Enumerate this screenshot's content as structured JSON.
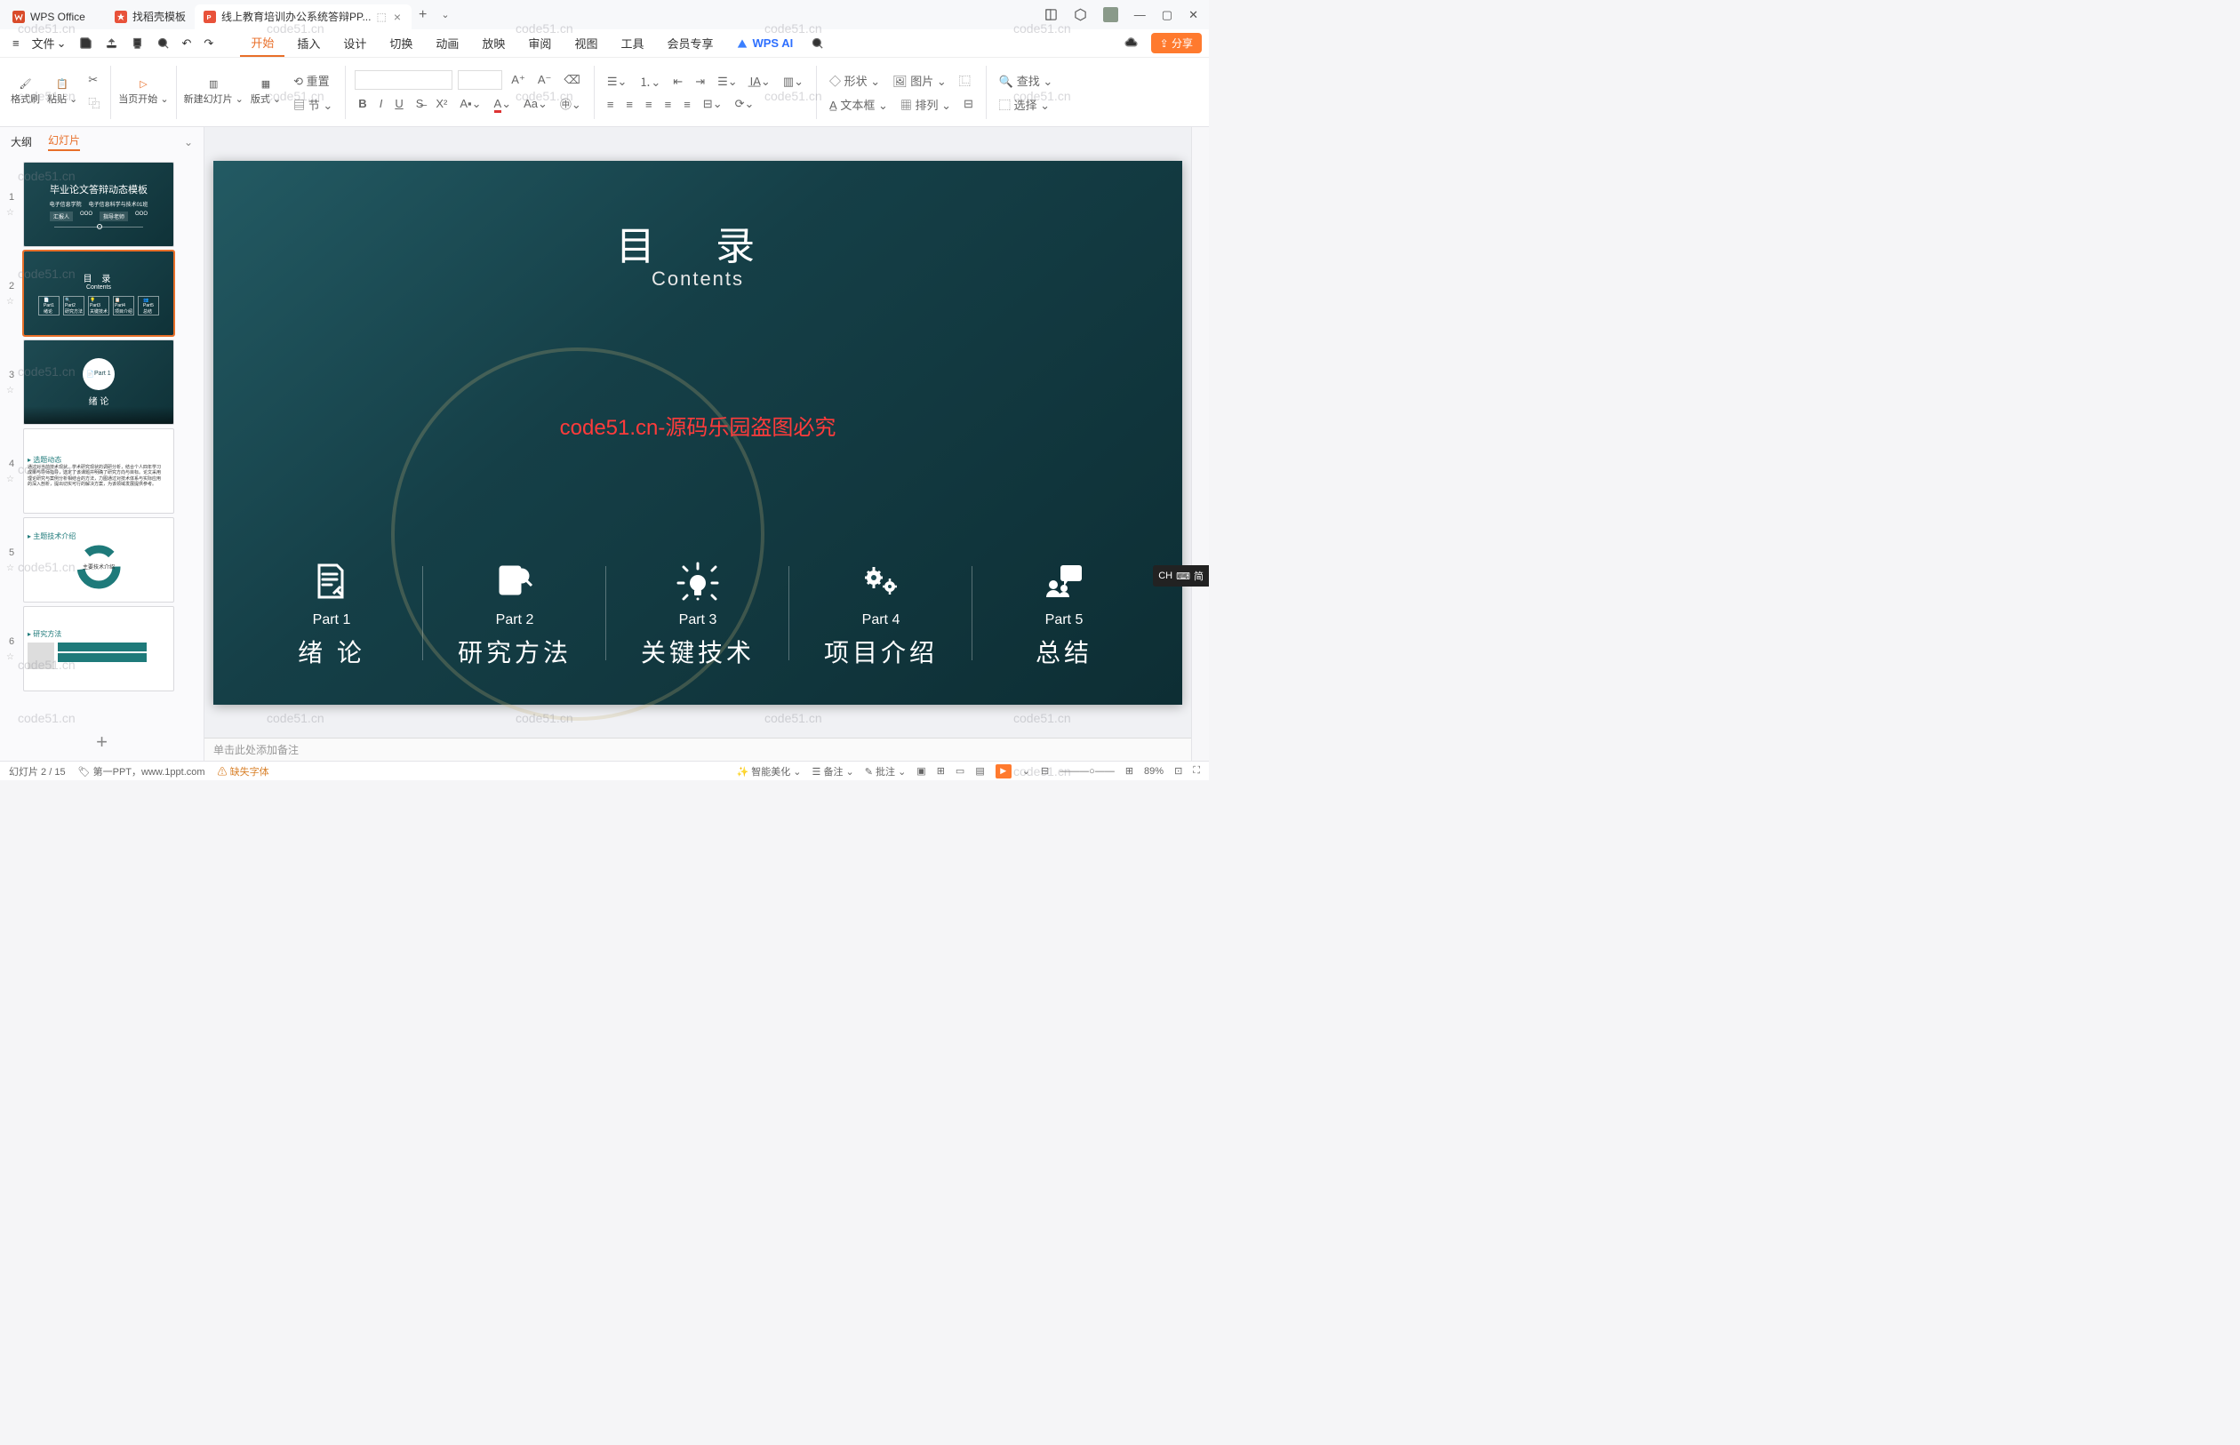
{
  "titlebar": {
    "home_label": "WPS Office",
    "tab2_label": "找稻壳模板",
    "tab3_label": "线上教育培训办公系统答辩PP..."
  },
  "menubar": {
    "file": "文件",
    "tabs": [
      "开始",
      "插入",
      "设计",
      "切换",
      "动画",
      "放映",
      "审阅",
      "视图",
      "工具",
      "会员专享"
    ],
    "active": 0,
    "ai": "WPS AI",
    "share": "分享"
  },
  "ribbon": {
    "format_brush": "格式刷",
    "paste": "粘贴",
    "from_current": "当页开始",
    "new_slide": "新建幻灯片",
    "layout": "版式",
    "section": "节",
    "reset": "重置",
    "shape": "形状",
    "picture": "图片",
    "textbox": "文本框",
    "arrange": "排列",
    "find": "查找",
    "select": "选择"
  },
  "leftpanel": {
    "outline": "大纲",
    "slides": "幻灯片"
  },
  "thumbs": [
    {
      "num": "1",
      "title": "毕业论文答辩动态模板",
      "sub1": "电子信息学院",
      "sub2": "电子信息科学与技术01班",
      "p1": "汇报人",
      "p2": "指导老师"
    },
    {
      "num": "2",
      "title": "目 录",
      "sub": "Contents"
    },
    {
      "num": "3",
      "part": "Part 1",
      "title": "绪 论"
    },
    {
      "num": "4",
      "title": "选题动态"
    },
    {
      "num": "5",
      "title": "主题技术介绍"
    },
    {
      "num": "6",
      "title": "研究方法"
    }
  ],
  "slide": {
    "title": "目 录",
    "subtitle": "Contents",
    "watermark": "code51.cn-源码乐园盗图必究",
    "parts": [
      {
        "label": "Part 1",
        "name": "绪 论"
      },
      {
        "label": "Part 2",
        "name": "研究方法"
      },
      {
        "label": "Part 3",
        "name": "关键技术"
      },
      {
        "label": "Part 4",
        "name": "项目介绍"
      },
      {
        "label": "Part 5",
        "name": "总结"
      }
    ]
  },
  "notes_placeholder": "单击此处添加备注",
  "statusbar": {
    "slide": "幻灯片 2 / 15",
    "template": "第一PPT，www.1ppt.com",
    "missing_font": "缺失字体",
    "beautify": "智能美化",
    "notes": "备注",
    "review": "批注",
    "zoom": "89%"
  },
  "ime": {
    "lang": "CH",
    "mode": "简"
  },
  "bg_watermark": "code51.cn"
}
